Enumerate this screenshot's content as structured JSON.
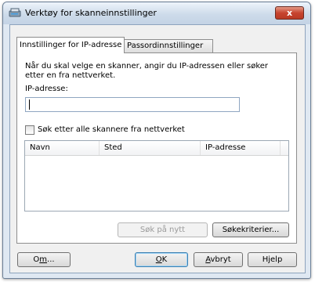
{
  "window": {
    "title": "Verktøy for skanneinnstillinger",
    "close_label": "x"
  },
  "tabs": [
    {
      "label": "Innstillinger for IP-adresse",
      "active": true
    },
    {
      "label": "Passordinnstillinger",
      "active": false
    }
  ],
  "ip_panel": {
    "instructions": "Når du skal velge en skanner, angir du IP-adressen eller søker etter en fra nettverket.",
    "ip_label": "IP-adresse:",
    "ip_value": "",
    "search_checkbox_label": "Søk etter alle skannere fra nettverket",
    "search_checkbox_checked": false,
    "scanner_list": {
      "columns": [
        "Navn",
        "Sted",
        "IP-adresse"
      ],
      "rows": []
    },
    "search_again_label": "Søk på nytt",
    "criteria_label": "Søkekriterier..."
  },
  "footer": {
    "about": {
      "mnemonic": "m",
      "rest": "O",
      "suffix": "..."
    },
    "ok": {
      "mnemonic": "O",
      "rest": "K"
    },
    "cancel": {
      "mnemonic": "A",
      "rest": "vbryt"
    },
    "help": {
      "prefix": "H",
      "mnemonic": "j",
      "rest": "elp"
    }
  }
}
